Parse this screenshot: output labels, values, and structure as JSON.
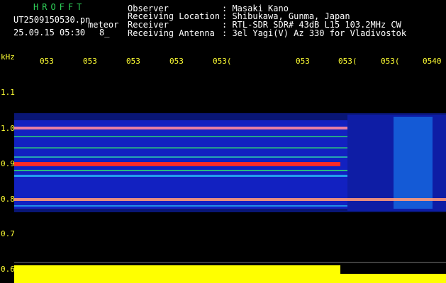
{
  "header": {
    "logo": "HROFFT",
    "filename": "UT2509150530.pn",
    "meteor_label": "meteor",
    "datetime": "25.09.15 05:30",
    "count": "8_",
    "fields": [
      {
        "label": "Observer",
        "value": ": Masaki Kano"
      },
      {
        "label": "Receiving Location",
        "value": ": Shibukawa, Gunma, Japan"
      },
      {
        "label": "Receiver",
        "value": ": RTL-SDR SDR# 43dB L15 103.2MHz CW"
      },
      {
        "label": "Receiving Antenna",
        "value": ": 3el Yagi(V) Az 330 for Vladivostok"
      }
    ]
  },
  "axis": {
    "unit": "kHz",
    "time_ticks": [
      "053",
      "053",
      "053",
      "053",
      "053(",
      "053",
      "053(",
      "053(",
      "0540"
    ],
    "freq_ticks": [
      "1.1",
      "1.0",
      "0.9",
      "0.8",
      "0.7",
      "0.6"
    ]
  },
  "colors": {
    "background": "#000000",
    "tick_text": "#ffff33",
    "logo": "#2fd35a",
    "signal_strong": "#ff2a2a",
    "signal_mid": "#33ff66",
    "noise": "#1a2cff",
    "level_bar": "#ffff00"
  }
}
